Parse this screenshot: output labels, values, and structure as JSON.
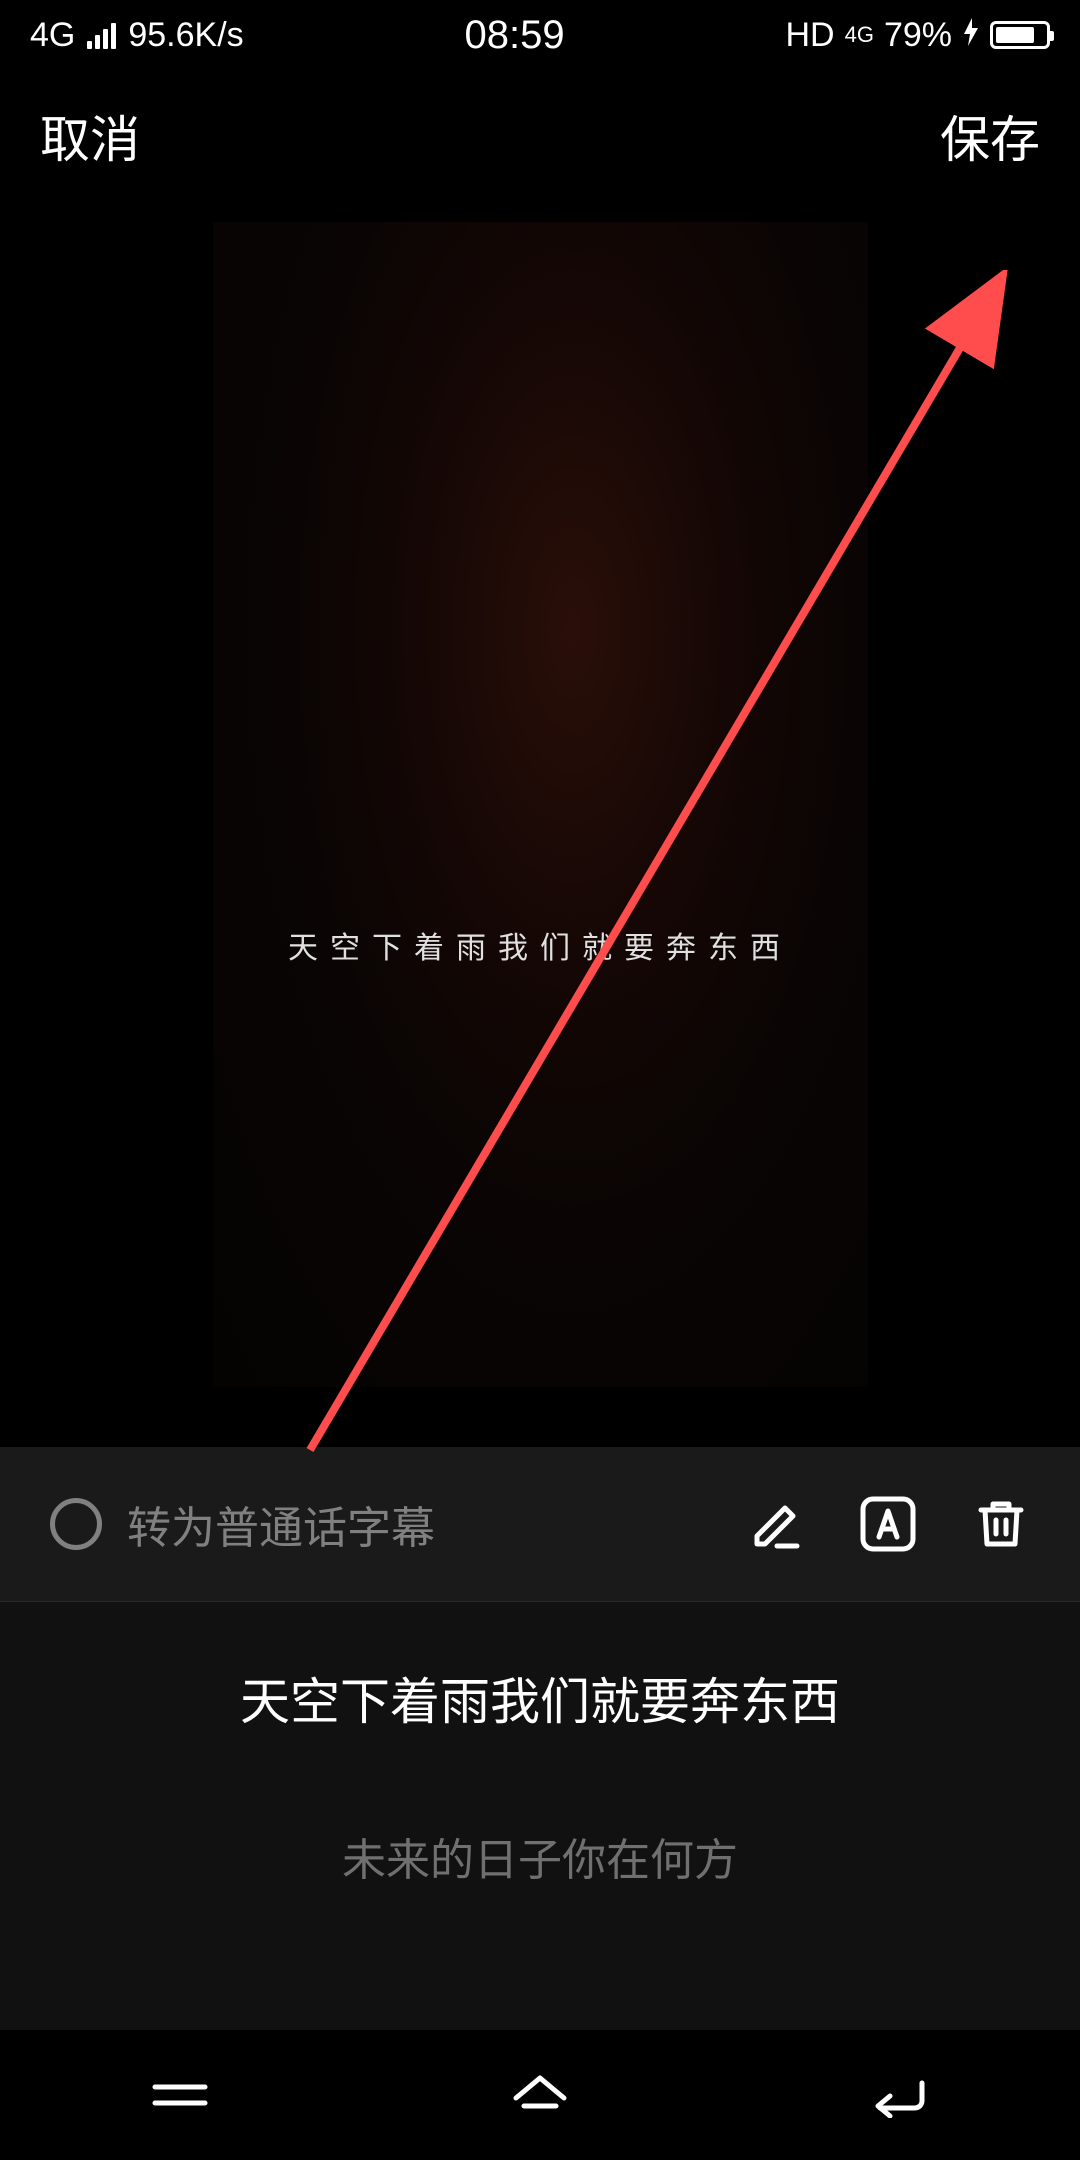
{
  "status_bar": {
    "network_type": "4G",
    "data_speed": "95.6K/s",
    "time": "08:59",
    "hd_indicator": "HD",
    "network_4g": "4G",
    "battery_percent": "79%"
  },
  "header": {
    "cancel_label": "取消",
    "save_label": "保存"
  },
  "preview": {
    "subtitle_text": "天空下着雨我们就要奔东西"
  },
  "toolbar": {
    "convert_label": "转为普通话字幕",
    "icons": {
      "edit": "edit-icon",
      "font": "font-icon",
      "delete": "delete-icon"
    }
  },
  "lyrics": {
    "current": "天空下着雨我们就要奔东西",
    "next": "未来的日子你在何方"
  },
  "colors": {
    "accent_red": "#ff4d4d",
    "text_muted": "#808080"
  }
}
